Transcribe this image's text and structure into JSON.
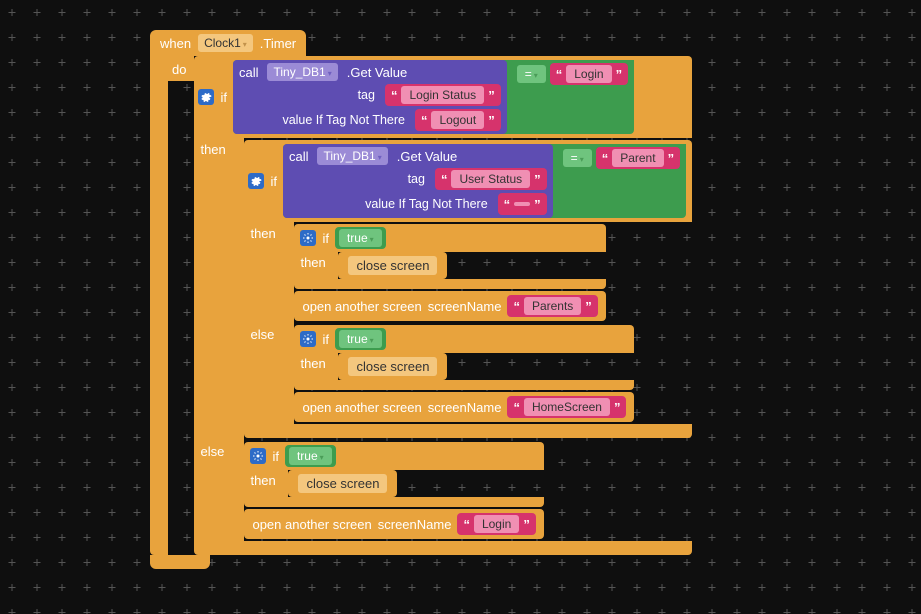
{
  "colors": {
    "orange": "#e8a33d",
    "purple": "#5e4db2",
    "green": "#3d9c4e",
    "magenta": "#d6336c"
  },
  "event": {
    "when": "when",
    "component": "Clock1",
    "event_name": ".Timer",
    "do": "do"
  },
  "outer_if": {
    "if": "if",
    "then": "then",
    "else": "else"
  },
  "call1": {
    "call": "call",
    "component": "Tiny_DB1",
    "method": ".Get Value",
    "arg1_label": "tag",
    "arg1_value": "Login Status",
    "arg2_label": "value If Tag Not There",
    "arg2_value": "Logout"
  },
  "compare1": {
    "op": "=",
    "rhs": "Login"
  },
  "inner_if": {
    "if": "if",
    "then": "then",
    "else": "else"
  },
  "call2": {
    "call": "call",
    "component": "Tiny_DB1",
    "method": ".Get Value",
    "arg1_label": "tag",
    "arg1_value": "User Status",
    "arg2_label": "value If Tag Not There",
    "arg2_value": ""
  },
  "compare2": {
    "op": "=",
    "rhs": "Parent"
  },
  "bool_true": "true",
  "close_screen": "close screen",
  "open_screen": {
    "label1": "open another screen",
    "label2": "screenName"
  },
  "screens": {
    "parents": "Parents",
    "home": "HomeScreen",
    "login": "Login"
  }
}
